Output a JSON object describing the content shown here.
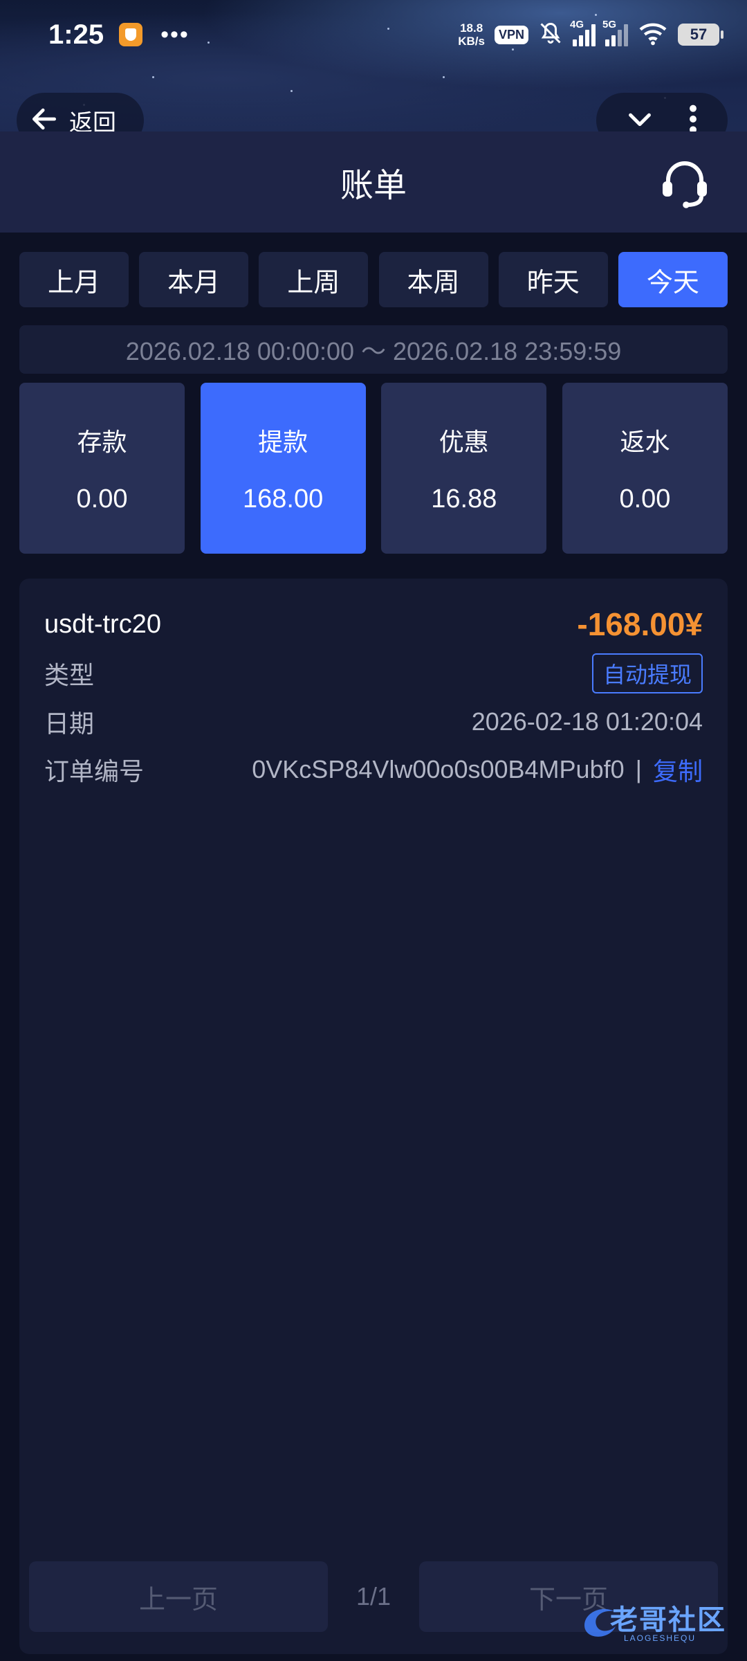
{
  "status_bar": {
    "time": "1:25",
    "net_speed_value": "18.8",
    "net_speed_unit": "KB/s",
    "vpn": "VPN",
    "net_4g": "4G",
    "net_5g": "5G",
    "battery": "57"
  },
  "nav": {
    "back_label": "返回"
  },
  "header": {
    "title": "账单"
  },
  "period_tabs": [
    {
      "label": "上月",
      "active": false
    },
    {
      "label": "本月",
      "active": false
    },
    {
      "label": "上周",
      "active": false
    },
    {
      "label": "本周",
      "active": false
    },
    {
      "label": "昨天",
      "active": false
    },
    {
      "label": "今天",
      "active": true
    }
  ],
  "date_range": "2026.02.18 00:00:00 ～ 2026.02.18 23:59:59",
  "summary": [
    {
      "label": "存款",
      "value": "0.00",
      "active": false
    },
    {
      "label": "提款",
      "value": "168.00",
      "active": true
    },
    {
      "label": "优惠",
      "value": "16.88",
      "active": false
    },
    {
      "label": "返水",
      "value": "0.00",
      "active": false
    }
  ],
  "record": {
    "channel": "usdt-trc20",
    "amount": "-168.00¥",
    "type_label": "类型",
    "type_value": "自动提现",
    "date_label": "日期",
    "date_value": "2026-02-18 01:20:04",
    "order_label": "订单编号",
    "order_value": "0VKcSP84Vlw00o0s00B4MPubf0",
    "separator": "|",
    "copy_label": "复制"
  },
  "pager": {
    "prev_label": "上一页",
    "page": "1/1",
    "next_label": "下一页"
  },
  "watermark": {
    "text": "老哥社区",
    "sub": "LAOGESHEQU"
  },
  "colors": {
    "accent": "#3d6bfd",
    "amount": "#f59233",
    "background": "#0d1124"
  }
}
